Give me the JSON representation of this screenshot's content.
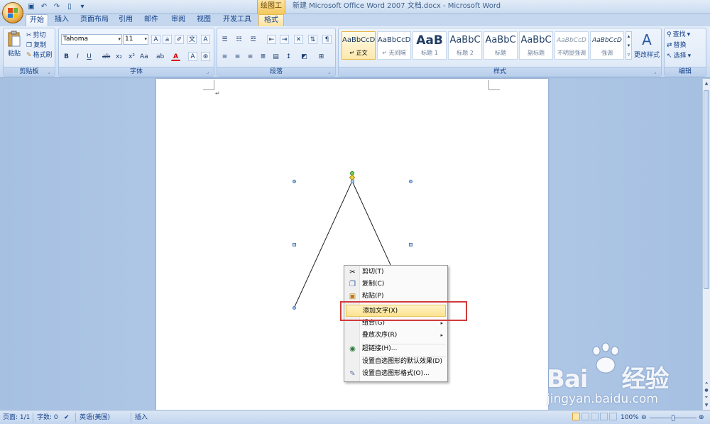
{
  "titlebar": {
    "context_tab_title": "绘图工具",
    "window_title": "新建 Microsoft Office Word 2007 文档.docx - Microsoft Word"
  },
  "tabs": [
    {
      "id": "home",
      "label": "开始",
      "active": true
    },
    {
      "id": "insert",
      "label": "插入"
    },
    {
      "id": "layout",
      "label": "页面布局"
    },
    {
      "id": "references",
      "label": "引用"
    },
    {
      "id": "mailings",
      "label": "邮件"
    },
    {
      "id": "review",
      "label": "审阅"
    },
    {
      "id": "view",
      "label": "视图"
    },
    {
      "id": "developer",
      "label": "开发工具"
    },
    {
      "id": "format",
      "label": "格式",
      "context": true
    }
  ],
  "clipboard": {
    "paste": "粘贴",
    "cut": "剪切",
    "copy": "复制",
    "format_painter": "格式刷",
    "group_label": "剪贴板"
  },
  "font": {
    "font_name": "Tahoma",
    "font_size": "11",
    "group_label": "字体"
  },
  "paragraph": {
    "group_label": "段落"
  },
  "styles": {
    "group_label": "样式",
    "change_styles": "更改样式",
    "items": [
      {
        "sample": "AaBbCcD",
        "name": "↵ 正文"
      },
      {
        "sample": "AaBbCcD",
        "name": "↵ 无间隔"
      },
      {
        "sample": "AaB",
        "name": "标题 1"
      },
      {
        "sample": "AaBbC",
        "name": "标题 2"
      },
      {
        "sample": "AaBbC",
        "name": "标题"
      },
      {
        "sample": "AaBbC",
        "name": "副标题"
      },
      {
        "sample": "AaBbCcD",
        "name": "不明显强调"
      },
      {
        "sample": "AaBbCcD",
        "name": "强调"
      }
    ]
  },
  "editing": {
    "group_label": "编辑",
    "find": "查找",
    "replace": "替换",
    "select": "选择"
  },
  "context_menu": {
    "items": [
      {
        "label": "剪切(T)",
        "icon": "scissors-icon"
      },
      {
        "label": "复制(C)",
        "icon": "copy-icon"
      },
      {
        "label": "粘贴(P)",
        "icon": "paste-icon"
      },
      {
        "label": "添加文字(X)",
        "highlighted": true
      },
      {
        "label": "组合(G)",
        "submenu": true
      },
      {
        "label": "叠放次序(R)",
        "submenu": true
      },
      {
        "label": "超链接(H)...",
        "icon": "hyperlink-icon"
      },
      {
        "label": "设置自选图形的默认效果(D)"
      },
      {
        "label": "设置自选图形格式(O)...",
        "icon": "format-shape-icon"
      }
    ]
  },
  "statusbar": {
    "page": "页面: 1/1",
    "words": "字数: 0",
    "language": "英语(美国)",
    "insert_mode": "插入",
    "zoom": "100%"
  },
  "watermark": {
    "main_left": "Bai",
    "main_right": "经验",
    "sub": "jingyan.baidu.com"
  },
  "colors": {
    "highlight_box": "#d23a3a",
    "font_color": "#d00000",
    "ribbon_text": "#15428b"
  }
}
